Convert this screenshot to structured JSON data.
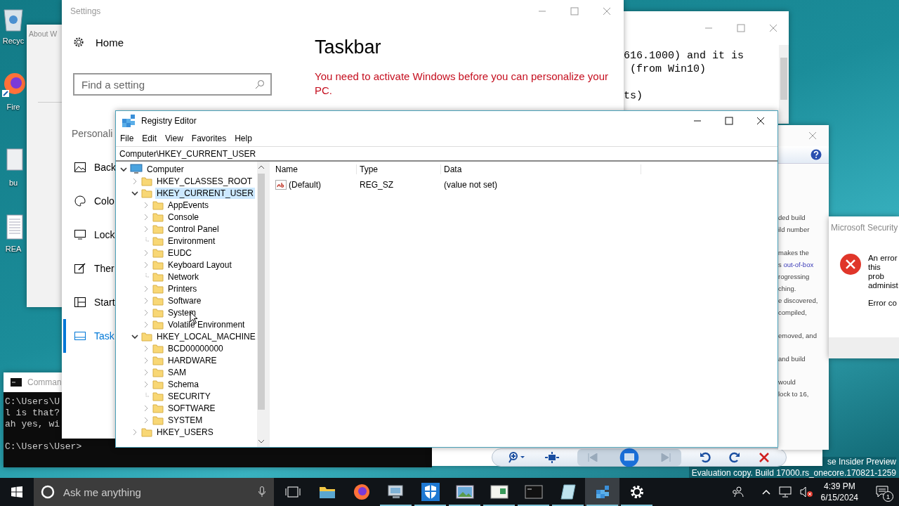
{
  "desktop": {
    "icons": [
      {
        "label": "Recyc",
        "kind": "recycle"
      },
      {
        "label": "Fire",
        "kind": "firefox"
      },
      {
        "label": "bu",
        "kind": "file"
      },
      {
        "label": "REA",
        "kind": "document"
      }
    ],
    "build_text": [
      "se Insider Preview",
      "Evaluation copy. Build 17000.rs_onecore.170821-1259"
    ]
  },
  "about_window": {
    "title": "About W"
  },
  "cmd": {
    "title": "Comman",
    "lines": [
      "C:\\Users\\U",
      "l is that?",
      "ah yes, wi"
    ],
    "prompt": "C:\\Users\\User>"
  },
  "settings": {
    "title": "Settings",
    "home": "Home",
    "search": {
      "placeholder": "Find a setting"
    },
    "section": "Personali",
    "nav": [
      {
        "label": "Back",
        "kind": "picture",
        "selected": false
      },
      {
        "label": "Colo",
        "kind": "palette",
        "selected": false
      },
      {
        "label": "Lock",
        "kind": "lock-screen",
        "selected": false
      },
      {
        "label": "Ther",
        "kind": "brush",
        "selected": false
      },
      {
        "label": "Start",
        "kind": "start",
        "selected": false
      },
      {
        "label": "Task",
        "kind": "taskbar",
        "selected": true
      }
    ],
    "heading": "Taskbar",
    "warning": "You need to activate Windows before you can personalize your PC."
  },
  "notepad": {
    "paragraphs": [
      [
        "616.1000) and it is",
        " (from Win10)"
      ],
      [
        "ts)"
      ]
    ]
  },
  "help_window": {
    "paragraphs": [
      [
        {
          "text": "ded build"
        },
        {
          "text": "ild number"
        }
      ],
      [
        {
          "text": "makes the"
        },
        {
          "text": "s",
          "link": "out-of-box"
        },
        {
          "text": "rogressing"
        },
        {
          "text": "ching."
        },
        {
          "text": "e discovered,"
        },
        {
          "text": "compiled,"
        }
      ],
      [
        {
          "text": "emoved, and"
        }
      ],
      [
        {
          "text": "and build"
        }
      ],
      [
        {
          "text": "would"
        },
        {
          "text": "lock to 16,"
        }
      ]
    ]
  },
  "security_dialog": {
    "title": "Microsoft Security",
    "message": [
      "An error",
      "this prob",
      "administ"
    ],
    "code": "Error co"
  },
  "regedit": {
    "title": "Registry Editor",
    "menu": [
      "File",
      "Edit",
      "View",
      "Favorites",
      "Help"
    ],
    "address": "Computer\\HKEY_CURRENT_USER",
    "tree": [
      {
        "label": "Computer",
        "kind": "computer",
        "expandable": true,
        "expanded": true,
        "selected": false,
        "children": [
          {
            "label": "HKEY_CLASSES_ROOT",
            "kind": "folder",
            "expandable": true,
            "expanded": false,
            "selected": false
          },
          {
            "label": "HKEY_CURRENT_USER",
            "kind": "folder",
            "expandable": true,
            "expanded": true,
            "selected": true,
            "children": [
              {
                "label": "AppEvents",
                "kind": "folder",
                "expandable": true,
                "expanded": false,
                "selected": false
              },
              {
                "label": "Console",
                "kind": "folder",
                "expandable": true,
                "expanded": false,
                "selected": false
              },
              {
                "label": "Control Panel",
                "kind": "folder",
                "expandable": true,
                "expanded": false,
                "selected": false
              },
              {
                "label": "Environment",
                "kind": "folder",
                "expandable": false,
                "selected": false
              },
              {
                "label": "EUDC",
                "kind": "folder",
                "expandable": true,
                "expanded": false,
                "selected": false
              },
              {
                "label": "Keyboard Layout",
                "kind": "folder",
                "expandable": true,
                "expanded": false,
                "selected": false
              },
              {
                "label": "Network",
                "kind": "folder",
                "expandable": false,
                "selected": false
              },
              {
                "label": "Printers",
                "kind": "folder",
                "expandable": true,
                "expanded": false,
                "selected": false
              },
              {
                "label": "Software",
                "kind": "folder",
                "expandable": true,
                "expanded": false,
                "selected": false
              },
              {
                "label": "System",
                "kind": "folder",
                "expandable": true,
                "expanded": false,
                "selected": false
              },
              {
                "label": "Volatile Environment",
                "kind": "folder",
                "expandable": true,
                "expanded": false,
                "selected": false
              }
            ]
          },
          {
            "label": "HKEY_LOCAL_MACHINE",
            "kind": "folder",
            "expandable": true,
            "expanded": true,
            "selected": false,
            "children": [
              {
                "label": "BCD00000000",
                "kind": "folder",
                "expandable": true,
                "expanded": false,
                "selected": false
              },
              {
                "label": "HARDWARE",
                "kind": "folder",
                "expandable": true,
                "expanded": false,
                "selected": false
              },
              {
                "label": "SAM",
                "kind": "folder",
                "expandable": true,
                "expanded": false,
                "selected": false
              },
              {
                "label": "Schema",
                "kind": "folder",
                "expandable": true,
                "expanded": false,
                "selected": false
              },
              {
                "label": "SECURITY",
                "kind": "folder",
                "expandable": false,
                "selected": false
              },
              {
                "label": "SOFTWARE",
                "kind": "folder",
                "expandable": true,
                "expanded": false,
                "selected": false
              },
              {
                "label": "SYSTEM",
                "kind": "folder",
                "expandable": true,
                "expanded": false,
                "selected": false
              }
            ]
          },
          {
            "label": "HKEY_USERS",
            "kind": "folder",
            "expandable": true,
            "expanded": false,
            "selected": false
          }
        ]
      }
    ],
    "columns": [
      "Name",
      "Type",
      "Data"
    ],
    "values": [
      {
        "name": "(Default)",
        "type": "REG_SZ",
        "data": "(value not set)"
      }
    ]
  },
  "taskbar": {
    "search": {
      "placeholder": "Ask me anything"
    },
    "apps": [
      {
        "kind": "explorer",
        "running": false,
        "active": false
      },
      {
        "kind": "firefox",
        "running": false,
        "active": false
      },
      {
        "kind": "computer",
        "running": true,
        "active": false
      },
      {
        "kind": "shield",
        "running": true,
        "active": false
      },
      {
        "kind": "photos",
        "running": true,
        "active": false
      },
      {
        "kind": "app-window",
        "running": true,
        "active": false
      },
      {
        "kind": "cmd",
        "running": true,
        "active": false
      },
      {
        "kind": "glass",
        "running": true,
        "active": false
      },
      {
        "kind": "regedit",
        "running": true,
        "active": true
      },
      {
        "kind": "settings",
        "running": true,
        "active": false
      }
    ],
    "clock": {
      "time": "4:39 PM",
      "date": "6/15/2024"
    },
    "notifications": "1"
  }
}
